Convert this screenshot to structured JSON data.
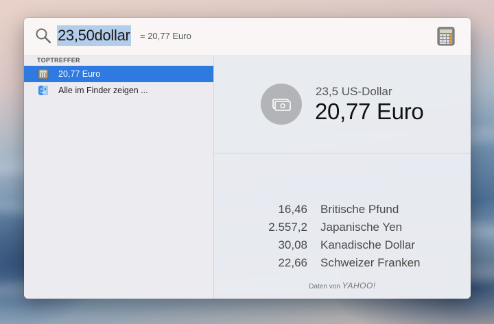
{
  "search": {
    "query": "23,50dollar",
    "inline_result": "= 20,77 Euro"
  },
  "results": {
    "section_header": "TOPTREFFER",
    "items": [
      {
        "label": "20,77 Euro",
        "icon": "calculator-icon",
        "selected": true
      },
      {
        "label": "Alle im Finder zeigen ...",
        "icon": "finder-icon",
        "selected": false
      }
    ]
  },
  "preview": {
    "source_amount": "23,5 US-Dollar",
    "converted_amount": "20,77 Euro",
    "conversions": [
      {
        "value": "16,46",
        "currency": "Britische Pfund"
      },
      {
        "value": "2.557,2",
        "currency": "Japanische Yen"
      },
      {
        "value": "30,08",
        "currency": "Kanadische Dollar"
      },
      {
        "value": "22,66",
        "currency": "Schweizer Franken"
      }
    ],
    "attribution_prefix": "Daten von",
    "attribution_brand": "YAHOO!"
  },
  "colors": {
    "selection": "#2e7ae0",
    "query_highlight": "#b3cdea"
  }
}
